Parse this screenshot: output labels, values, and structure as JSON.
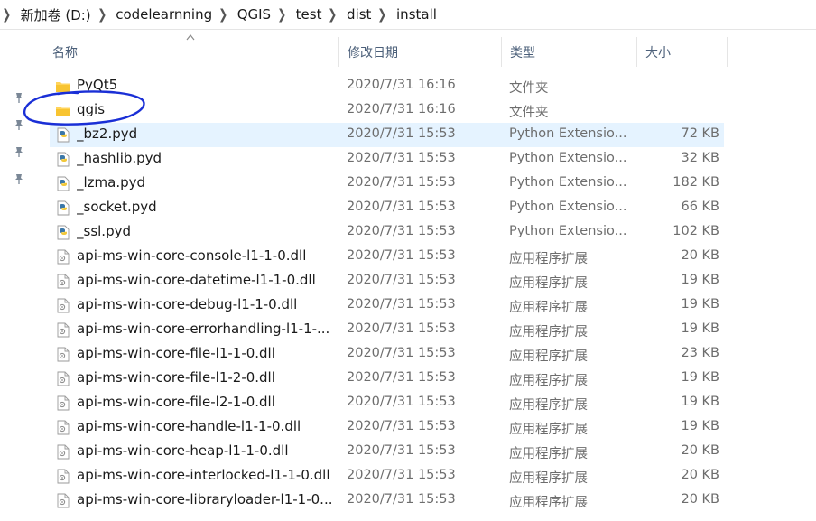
{
  "breadcrumb": {
    "items": [
      "新加卷 (D:)",
      "codelearnning",
      "QGIS",
      "test",
      "dist",
      "install"
    ]
  },
  "columns": {
    "name": "名称",
    "date": "修改日期",
    "type": "类型",
    "size": "大小"
  },
  "files": [
    {
      "name": "PyQt5",
      "date": "2020/7/31 16:16",
      "type": "文件夹",
      "size": "",
      "icon": "folder-icon"
    },
    {
      "name": "qgis",
      "date": "2020/7/31 16:16",
      "type": "文件夹",
      "size": "",
      "icon": "folder-icon"
    },
    {
      "name": "_bz2.pyd",
      "date": "2020/7/31 15:53",
      "type": "Python Extensio...",
      "size": "72 KB",
      "icon": "python-file-icon"
    },
    {
      "name": "_hashlib.pyd",
      "date": "2020/7/31 15:53",
      "type": "Python Extensio...",
      "size": "32 KB",
      "icon": "python-file-icon"
    },
    {
      "name": "_lzma.pyd",
      "date": "2020/7/31 15:53",
      "type": "Python Extensio...",
      "size": "182 KB",
      "icon": "python-file-icon"
    },
    {
      "name": "_socket.pyd",
      "date": "2020/7/31 15:53",
      "type": "Python Extensio...",
      "size": "66 KB",
      "icon": "python-file-icon"
    },
    {
      "name": "_ssl.pyd",
      "date": "2020/7/31 15:53",
      "type": "Python Extensio...",
      "size": "102 KB",
      "icon": "python-file-icon"
    },
    {
      "name": "api-ms-win-core-console-l1-1-0.dll",
      "date": "2020/7/31 15:53",
      "type": "应用程序扩展",
      "size": "20 KB",
      "icon": "dll-file-icon"
    },
    {
      "name": "api-ms-win-core-datetime-l1-1-0.dll",
      "date": "2020/7/31 15:53",
      "type": "应用程序扩展",
      "size": "19 KB",
      "icon": "dll-file-icon"
    },
    {
      "name": "api-ms-win-core-debug-l1-1-0.dll",
      "date": "2020/7/31 15:53",
      "type": "应用程序扩展",
      "size": "19 KB",
      "icon": "dll-file-icon"
    },
    {
      "name": "api-ms-win-core-errorhandling-l1-1-...",
      "date": "2020/7/31 15:53",
      "type": "应用程序扩展",
      "size": "19 KB",
      "icon": "dll-file-icon"
    },
    {
      "name": "api-ms-win-core-file-l1-1-0.dll",
      "date": "2020/7/31 15:53",
      "type": "应用程序扩展",
      "size": "23 KB",
      "icon": "dll-file-icon"
    },
    {
      "name": "api-ms-win-core-file-l1-2-0.dll",
      "date": "2020/7/31 15:53",
      "type": "应用程序扩展",
      "size": "19 KB",
      "icon": "dll-file-icon"
    },
    {
      "name": "api-ms-win-core-file-l2-1-0.dll",
      "date": "2020/7/31 15:53",
      "type": "应用程序扩展",
      "size": "19 KB",
      "icon": "dll-file-icon"
    },
    {
      "name": "api-ms-win-core-handle-l1-1-0.dll",
      "date": "2020/7/31 15:53",
      "type": "应用程序扩展",
      "size": "19 KB",
      "icon": "dll-file-icon"
    },
    {
      "name": "api-ms-win-core-heap-l1-1-0.dll",
      "date": "2020/7/31 15:53",
      "type": "应用程序扩展",
      "size": "20 KB",
      "icon": "dll-file-icon"
    },
    {
      "name": "api-ms-win-core-interlocked-l1-1-0.dll",
      "date": "2020/7/31 15:53",
      "type": "应用程序扩展",
      "size": "20 KB",
      "icon": "dll-file-icon"
    },
    {
      "name": "api-ms-win-core-libraryloader-l1-1-0...",
      "date": "2020/7/31 15:53",
      "type": "应用程序扩展",
      "size": "20 KB",
      "icon": "dll-file-icon"
    }
  ],
  "selected_file": "_bz2.pyd",
  "annotation": {
    "color": "#1a2fd6"
  }
}
